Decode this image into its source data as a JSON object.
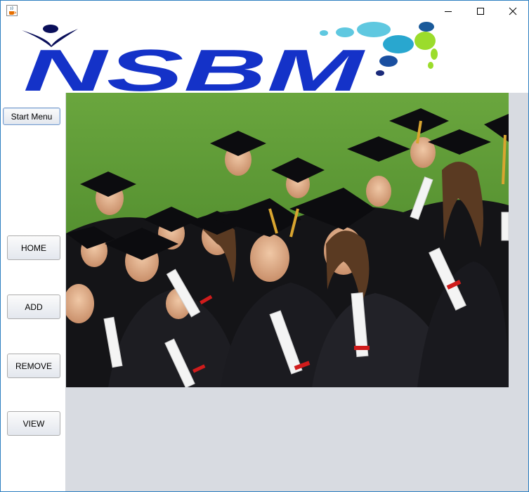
{
  "window": {
    "controls": {
      "minimize_icon": "minimize-icon",
      "maximize_icon": "maximize-icon",
      "close_icon": "close-icon"
    },
    "app_icon": "java-cup-icon"
  },
  "logo": {
    "text": "NSBM",
    "colors": {
      "letters": "#1432c8",
      "swoosh": "#0a0f5a",
      "bubbles": [
        "#5fc8e0",
        "#29a7cf",
        "#9bdc2b",
        "#1a2a7a"
      ]
    }
  },
  "sidebar": {
    "start_menu_label": "Start Menu",
    "home_label": "HOME",
    "add_label": "ADD",
    "remove_label": "REMOVE",
    "view_label": "VIEW"
  },
  "main": {
    "background": "#d8dbe1",
    "photo_subject": "graduates-group-photo"
  }
}
